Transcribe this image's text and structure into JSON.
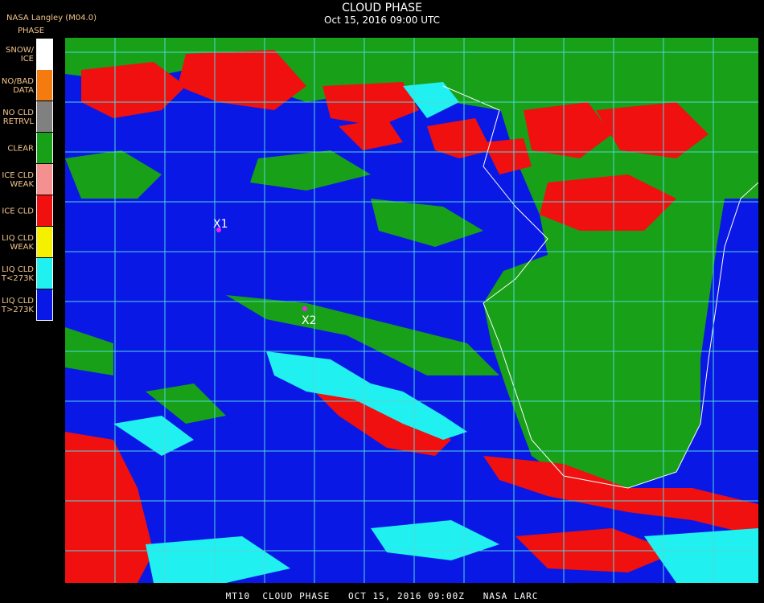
{
  "header": {
    "title": "CLOUD PHASE",
    "subtitle": "Oct 15, 2016 09:00 UTC",
    "source": "NASA Langley (M04.0)",
    "legend_title": "PHASE"
  },
  "legend": [
    {
      "label": "SNOW/\nICE",
      "color": "#ffffff"
    },
    {
      "label": "NO/BAD\nDATA",
      "color": "#f47b10"
    },
    {
      "label": "NO CLD\nRETRVL",
      "color": "#808080"
    },
    {
      "label": "CLEAR",
      "color": "#18a018"
    },
    {
      "label": "ICE CLD\nWEAK",
      "color": "#f49090"
    },
    {
      "label": "ICE CLD",
      "color": "#f01010"
    },
    {
      "label": "LIQ CLD\nWEAK",
      "color": "#f4f000"
    },
    {
      "label": "LIQ CLD\nT<273K",
      "color": "#20f0f0"
    },
    {
      "label": "LIQ CLD\nT>273K",
      "color": "#0a18e6"
    }
  ],
  "markers": [
    {
      "label": "X1",
      "color": "#f020f0"
    },
    {
      "label": "X2",
      "color": "#f020f0"
    }
  ],
  "footer": "MT10  CLOUD PHASE   OCT 15, 2016 09:00Z   NASA LARC"
}
